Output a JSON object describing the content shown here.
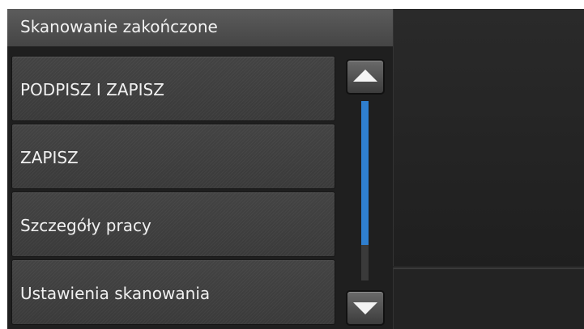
{
  "header": {
    "title": "Skanowanie zakończone"
  },
  "menu": {
    "items": [
      {
        "label": "PODPISZ I ZAPISZ"
      },
      {
        "label": "ZAPISZ"
      },
      {
        "label": "Szczegóły pracy"
      },
      {
        "label": "Ustawienia skanowania"
      }
    ]
  },
  "scrollbar": {
    "up_icon": "triangle-up-icon",
    "down_icon": "triangle-down-icon",
    "thumb_color": "#2f7fcf",
    "thumb_fraction": 0.8
  },
  "colors": {
    "title_bar": "#505050",
    "background": "#1f1f1f",
    "text": "#f0f0f0"
  }
}
